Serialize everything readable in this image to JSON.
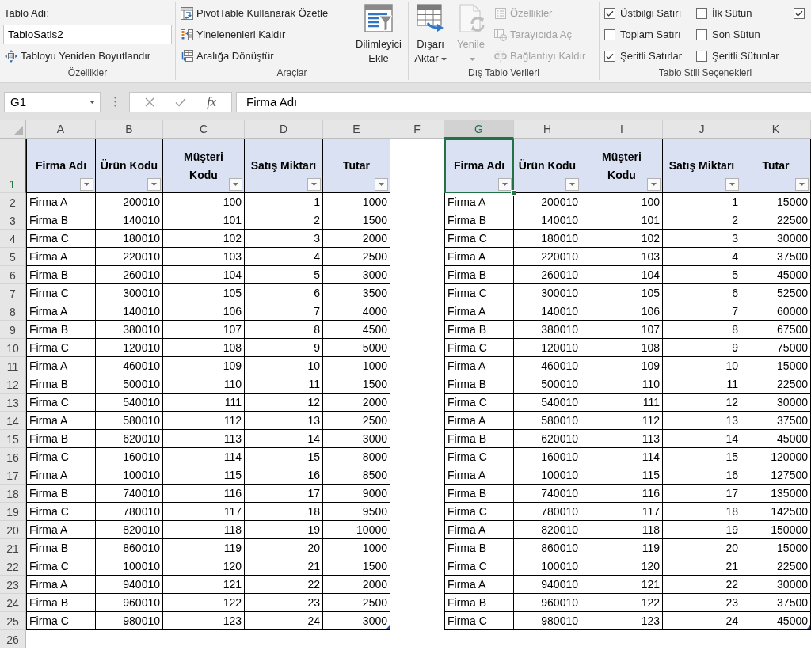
{
  "ribbon": {
    "groups": [
      {
        "label": "Özellikler",
        "items": [
          {
            "kind": "field",
            "label": "Tablo Adı:",
            "value": "TabloSatis2"
          },
          {
            "kind": "small",
            "label": "Tabloyu Yeniden Boyutlandır",
            "disabled": false
          }
        ]
      },
      {
        "label": "Araçlar",
        "items": [
          {
            "kind": "small",
            "label": "PivotTable Kullanarak Özetle",
            "disabled": false
          },
          {
            "kind": "small",
            "label": "Yinelenenleri Kaldır",
            "disabled": false
          },
          {
            "kind": "small",
            "label": "Aralığa Dönüştür",
            "disabled": false
          },
          {
            "kind": "large",
            "label": "Dilimleyici Ekle",
            "disabled": false,
            "dropdown": false
          }
        ]
      },
      {
        "label": "Dış Tablo Verileri",
        "items": [
          {
            "kind": "large",
            "label": "Dışarı Aktar",
            "disabled": false,
            "dropdown": true
          },
          {
            "kind": "large",
            "label": "Yenile",
            "disabled": true,
            "dropdown": true
          },
          {
            "kind": "small",
            "label": "Özellikler",
            "disabled": true
          },
          {
            "kind": "small",
            "label": "Tarayıcıda Aç",
            "disabled": true
          },
          {
            "kind": "small",
            "label": "Bağlantıyı Kaldır",
            "disabled": true
          }
        ]
      },
      {
        "label": "Tablo Stili Seçenekleri",
        "items": [
          {
            "kind": "checkbox",
            "label": "Üstbilgi Satırı",
            "checked": true
          },
          {
            "kind": "checkbox",
            "label": "Toplam Satırı",
            "checked": false
          },
          {
            "kind": "checkbox",
            "label": "Şeritli Satırlar",
            "checked": true
          },
          {
            "kind": "checkbox",
            "label": "İlk Sütun",
            "checked": false
          },
          {
            "kind": "checkbox",
            "label": "Son Sütun",
            "checked": false
          },
          {
            "kind": "checkbox",
            "label": "Şeritli Sütunlar",
            "checked": false
          },
          {
            "kind": "checkbox",
            "checked": true
          }
        ]
      }
    ]
  },
  "formula_bar": {
    "name_box": "G1",
    "function_button": "fx",
    "value": "Firma Adı"
  },
  "sheet": {
    "column_headers": [
      {
        "letter": "A",
        "selected": false
      },
      {
        "letter": "B",
        "selected": false
      },
      {
        "letter": "C",
        "selected": false
      },
      {
        "letter": "D",
        "selected": false
      },
      {
        "letter": "E",
        "selected": false
      },
      {
        "letter": "F",
        "selected": false
      },
      {
        "letter": "G",
        "selected": true
      },
      {
        "letter": "H",
        "selected": false
      },
      {
        "letter": "I",
        "selected": false
      },
      {
        "letter": "J",
        "selected": false
      },
      {
        "letter": "K",
        "selected": false
      }
    ],
    "row_headers": [
      {
        "number": "1",
        "selected": true
      },
      {
        "number": "2",
        "selected": false
      },
      {
        "number": "3",
        "selected": false
      },
      {
        "number": "4",
        "selected": false
      },
      {
        "number": "5",
        "selected": false
      },
      {
        "number": "6",
        "selected": false
      },
      {
        "number": "7",
        "selected": false
      },
      {
        "number": "8",
        "selected": false
      },
      {
        "number": "9",
        "selected": false
      },
      {
        "number": "10",
        "selected": false
      },
      {
        "number": "11",
        "selected": false
      },
      {
        "number": "12",
        "selected": false
      },
      {
        "number": "13",
        "selected": false
      },
      {
        "number": "14",
        "selected": false
      },
      {
        "number": "15",
        "selected": false
      },
      {
        "number": "16",
        "selected": false
      },
      {
        "number": "17",
        "selected": false
      },
      {
        "number": "18",
        "selected": false
      },
      {
        "number": "19",
        "selected": false
      },
      {
        "number": "20",
        "selected": false
      },
      {
        "number": "21",
        "selected": false
      },
      {
        "number": "22",
        "selected": false
      },
      {
        "number": "23",
        "selected": false
      },
      {
        "number": "24",
        "selected": false
      },
      {
        "number": "25",
        "selected": false
      },
      {
        "number": "26",
        "selected": false
      }
    ],
    "tables": [
      {
        "columns": [
          {
            "label": "Firma Adı",
            "kind": "text"
          },
          {
            "label": "Ürün Kodu",
            "kind": "number"
          },
          {
            "label": "Müşteri Kodu",
            "kind": "number"
          },
          {
            "label": "Satış Miktarı",
            "kind": "number"
          },
          {
            "label": "Tutar",
            "kind": "number"
          }
        ],
        "rows": [
          [
            "Firma A",
            "200010",
            "100",
            "1",
            "1000"
          ],
          [
            "Firma B",
            "140010",
            "101",
            "2",
            "1500"
          ],
          [
            "Firma C",
            "180010",
            "102",
            "3",
            "2000"
          ],
          [
            "Firma A",
            "220010",
            "103",
            "4",
            "2500"
          ],
          [
            "Firma B",
            "260010",
            "104",
            "5",
            "3000"
          ],
          [
            "Firma C",
            "300010",
            "105",
            "6",
            "3500"
          ],
          [
            "Firma A",
            "140010",
            "106",
            "7",
            "4000"
          ],
          [
            "Firma B",
            "380010",
            "107",
            "8",
            "4500"
          ],
          [
            "Firma C",
            "120010",
            "108",
            "9",
            "5000"
          ],
          [
            "Firma A",
            "460010",
            "109",
            "10",
            "1000"
          ],
          [
            "Firma B",
            "500010",
            "110",
            "11",
            "1500"
          ],
          [
            "Firma C",
            "540010",
            "111",
            "12",
            "2000"
          ],
          [
            "Firma A",
            "580010",
            "112",
            "13",
            "2500"
          ],
          [
            "Firma B",
            "620010",
            "113",
            "14",
            "3000"
          ],
          [
            "Firma C",
            "160010",
            "114",
            "15",
            "8000"
          ],
          [
            "Firma A",
            "100010",
            "115",
            "16",
            "8500"
          ],
          [
            "Firma B",
            "740010",
            "116",
            "17",
            "9000"
          ],
          [
            "Firma C",
            "780010",
            "117",
            "18",
            "9500"
          ],
          [
            "Firma A",
            "820010",
            "118",
            "19",
            "10000"
          ],
          [
            "Firma B",
            "860010",
            "119",
            "20",
            "1000"
          ],
          [
            "Firma C",
            "100010",
            "120",
            "21",
            "1500"
          ],
          [
            "Firma A",
            "940010",
            "121",
            "22",
            "2000"
          ],
          [
            "Firma B",
            "960010",
            "122",
            "23",
            "2500"
          ],
          [
            "Firma C",
            "980010",
            "123",
            "24",
            "3000"
          ]
        ]
      },
      {
        "columns": [
          {
            "label": "Firma Adı",
            "kind": "text"
          },
          {
            "label": "Ürün Kodu",
            "kind": "number"
          },
          {
            "label": "Müşteri Kodu",
            "kind": "number"
          },
          {
            "label": "Satış Miktarı",
            "kind": "number"
          },
          {
            "label": "Tutar",
            "kind": "number"
          }
        ],
        "rows": [
          [
            "Firma A",
            "200010",
            "100",
            "1",
            "15000"
          ],
          [
            "Firma B",
            "140010",
            "101",
            "2",
            "22500"
          ],
          [
            "Firma C",
            "180010",
            "102",
            "3",
            "30000"
          ],
          [
            "Firma A",
            "220010",
            "103",
            "4",
            "37500"
          ],
          [
            "Firma B",
            "260010",
            "104",
            "5",
            "45000"
          ],
          [
            "Firma C",
            "300010",
            "105",
            "6",
            "52500"
          ],
          [
            "Firma A",
            "140010",
            "106",
            "7",
            "60000"
          ],
          [
            "Firma B",
            "380010",
            "107",
            "8",
            "67500"
          ],
          [
            "Firma C",
            "120010",
            "108",
            "9",
            "75000"
          ],
          [
            "Firma A",
            "460010",
            "109",
            "10",
            "15000"
          ],
          [
            "Firma B",
            "500010",
            "110",
            "11",
            "22500"
          ],
          [
            "Firma C",
            "540010",
            "111",
            "12",
            "30000"
          ],
          [
            "Firma A",
            "580010",
            "112",
            "13",
            "37500"
          ],
          [
            "Firma B",
            "620010",
            "113",
            "14",
            "45000"
          ],
          [
            "Firma C",
            "160010",
            "114",
            "15",
            "120000"
          ],
          [
            "Firma A",
            "100010",
            "115",
            "16",
            "127500"
          ],
          [
            "Firma B",
            "740010",
            "116",
            "17",
            "135000"
          ],
          [
            "Firma C",
            "780010",
            "117",
            "18",
            "142500"
          ],
          [
            "Firma A",
            "820010",
            "118",
            "19",
            "150000"
          ],
          [
            "Firma B",
            "860010",
            "119",
            "20",
            "15000"
          ],
          [
            "Firma C",
            "100010",
            "120",
            "21",
            "22500"
          ],
          [
            "Firma A",
            "940010",
            "121",
            "22",
            "30000"
          ],
          [
            "Firma B",
            "960010",
            "122",
            "23",
            "37500"
          ],
          [
            "Firma C",
            "980010",
            "123",
            "24",
            "45000"
          ]
        ]
      }
    ]
  }
}
